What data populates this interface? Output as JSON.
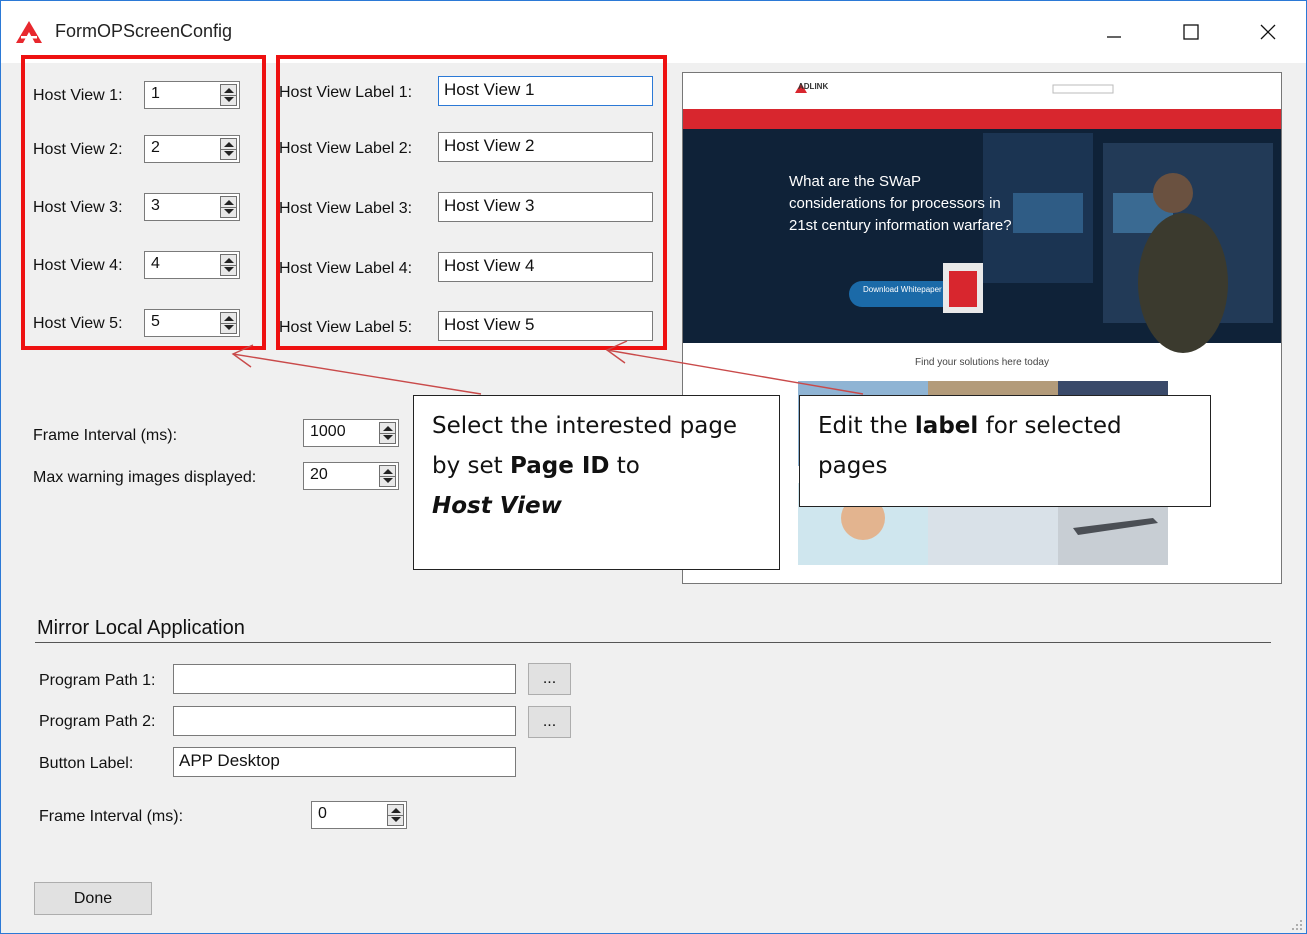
{
  "window": {
    "title": "FormOPScreenConfig"
  },
  "host_views": [
    {
      "label": "Host View 1:",
      "value": "1",
      "label_caption": "Host View Label 1:",
      "label_value": "Host View 1"
    },
    {
      "label": "Host View 2:",
      "value": "2",
      "label_caption": "Host View Label 2:",
      "label_value": "Host View 2"
    },
    {
      "label": "Host View 3:",
      "value": "3",
      "label_caption": "Host View Label 3:",
      "label_value": "Host View 3"
    },
    {
      "label": "Host View 4:",
      "value": "4",
      "label_caption": "Host View Label 4:",
      "label_value": "Host View 4"
    },
    {
      "label": "Host View 5:",
      "value": "5",
      "label_caption": "Host View Label 5:",
      "label_value": "Host View 5"
    }
  ],
  "settings": {
    "frame_interval_label": "Frame Interval (ms):",
    "frame_interval_value": "1000",
    "max_warning_label": "Max warning images displayed:",
    "max_warning_value": "20"
  },
  "callouts": {
    "left": {
      "text1": "Select the interested page by set ",
      "bold": "Page ID",
      "text2": " to ",
      "bold_italic": "Host View"
    },
    "right": {
      "text1": "Edit the ",
      "bold": "label",
      "text2": " for selected pages"
    }
  },
  "preview": {
    "brand": "ADLINK",
    "headline": "What are the SWaP considerations for processors in 21st century information warfare?",
    "cta": "Download Whitepaper",
    "subheading": "Find your solutions here today"
  },
  "mirror": {
    "section_title": "Mirror Local Application",
    "path1_label": "Program Path 1:",
    "path1_value": "",
    "path2_label": "Program Path 2:",
    "path2_value": "",
    "browse_label": "...",
    "button_label_caption": "Button Label:",
    "button_label_value": "APP Desktop",
    "frame_interval_label": "Frame Interval (ms):",
    "frame_interval_value": "0"
  },
  "footer": {
    "done_label": "Done"
  },
  "colors": {
    "accent": "#ee1111",
    "window_border": "#2b79d6",
    "adlink_red": "#d8262e",
    "background": "#f0f0f0"
  }
}
